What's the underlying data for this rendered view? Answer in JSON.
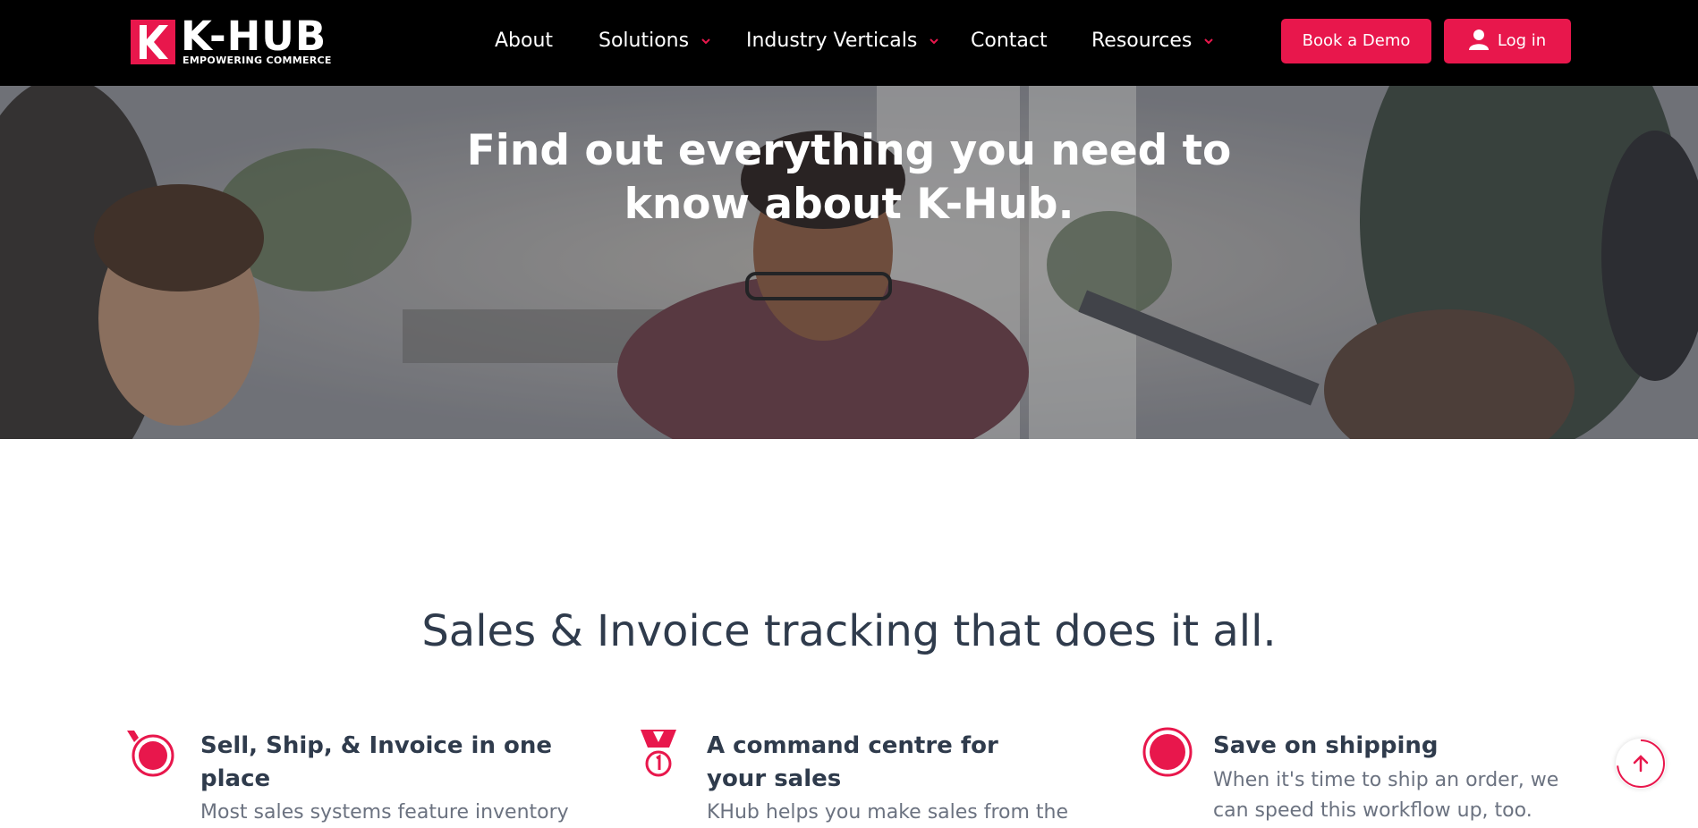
{
  "brand": {
    "name": "K-HUB",
    "tagline": "EMPOWERING COMMERCE",
    "accent": "#e8174c"
  },
  "nav": {
    "items": [
      {
        "label": "About",
        "has_dropdown": false
      },
      {
        "label": "Solutions",
        "has_dropdown": true
      },
      {
        "label": "Industry Verticals",
        "has_dropdown": true
      },
      {
        "label": "Contact",
        "has_dropdown": false
      },
      {
        "label": "Resources",
        "has_dropdown": true
      }
    ],
    "demo_label": "Book a Demo",
    "login_label": "Log in",
    "login_icon": "user-icon"
  },
  "hero": {
    "title": "Find out everything you need to know about K-Hub."
  },
  "section": {
    "title": "Sales & Invoice tracking that does it all.",
    "features": [
      {
        "icon": "target-icon",
        "title": "Sell, Ship, & Invoice in one place",
        "text": "Most sales systems feature inventory"
      },
      {
        "icon": "medal-icon",
        "title": "A command centre for your sales",
        "text": "KHub helps you make sales from the"
      },
      {
        "icon": "circle-icon",
        "title": "Save on shipping",
        "text": "When it's time to ship an order, we can speed this workflow up, too."
      }
    ]
  },
  "scroll_top_icon": "arrow-up-icon"
}
